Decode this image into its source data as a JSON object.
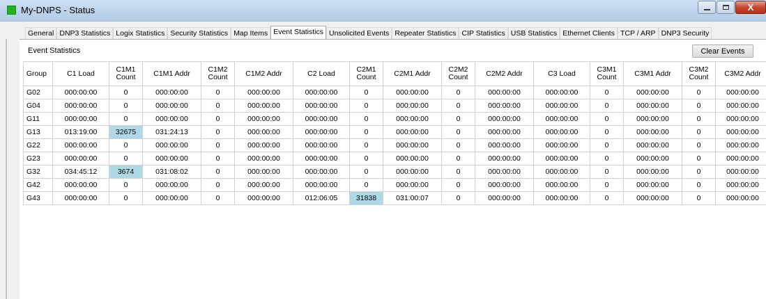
{
  "window": {
    "title": "My-DNPS - Status",
    "icon_color": "#1fb31f",
    "minimize_icon": "minimize-icon",
    "maximize_icon": "maximize-icon",
    "close_label": "X"
  },
  "tabs": [
    {
      "label": "General",
      "active": false
    },
    {
      "label": "DNP3 Statistics",
      "active": false
    },
    {
      "label": "Logix Statistics",
      "active": false
    },
    {
      "label": "Security Statistics",
      "active": false
    },
    {
      "label": "Map Items",
      "active": false
    },
    {
      "label": "Event Statistics",
      "active": true
    },
    {
      "label": "Unsolicited Events",
      "active": false
    },
    {
      "label": "Repeater Statistics",
      "active": false
    },
    {
      "label": "CIP Statistics",
      "active": false
    },
    {
      "label": "USB Statistics",
      "active": false
    },
    {
      "label": "Ethernet Clients",
      "active": false
    },
    {
      "label": "TCP / ARP",
      "active": false
    },
    {
      "label": "DNP3 Security",
      "active": false
    }
  ],
  "panel": {
    "title": "Event Statistics",
    "clear_button": "Clear Events"
  },
  "table": {
    "highlight_color": "#add8e6",
    "headers": [
      [
        "Group"
      ],
      [
        "C1 Load"
      ],
      [
        "C1M1",
        "Count"
      ],
      [
        "C1M1 Addr"
      ],
      [
        "C1M2",
        "Count"
      ],
      [
        "C1M2 Addr"
      ],
      [
        "C2 Load"
      ],
      [
        "C2M1",
        "Count"
      ],
      [
        "C2M1 Addr"
      ],
      [
        "C2M2",
        "Count"
      ],
      [
        "C2M2 Addr"
      ],
      [
        "C3 Load"
      ],
      [
        "C3M1",
        "Count"
      ],
      [
        "C3M1 Addr"
      ],
      [
        "C3M2",
        "Count"
      ],
      [
        "C3M2 Addr"
      ]
    ],
    "rows": [
      {
        "cells": [
          "G02",
          "000:00:00",
          "0",
          "000:00:00",
          "0",
          "000:00:00",
          "000:00:00",
          "0",
          "000:00:00",
          "0",
          "000:00:00",
          "000:00:00",
          "0",
          "000:00:00",
          "0",
          "000:00:00"
        ],
        "highlight": []
      },
      {
        "cells": [
          "G04",
          "000:00:00",
          "0",
          "000:00:00",
          "0",
          "000:00:00",
          "000:00:00",
          "0",
          "000:00:00",
          "0",
          "000:00:00",
          "000:00:00",
          "0",
          "000:00:00",
          "0",
          "000:00:00"
        ],
        "highlight": []
      },
      {
        "cells": [
          "G11",
          "000:00:00",
          "0",
          "000:00:00",
          "0",
          "000:00:00",
          "000:00:00",
          "0",
          "000:00:00",
          "0",
          "000:00:00",
          "000:00:00",
          "0",
          "000:00:00",
          "0",
          "000:00:00"
        ],
        "highlight": []
      },
      {
        "cells": [
          "G13",
          "013:19:00",
          "32675",
          "031:24:13",
          "0",
          "000:00:00",
          "000:00:00",
          "0",
          "000:00:00",
          "0",
          "000:00:00",
          "000:00:00",
          "0",
          "000:00:00",
          "0",
          "000:00:00"
        ],
        "highlight": [
          2
        ]
      },
      {
        "cells": [
          "G22",
          "000:00:00",
          "0",
          "000:00:00",
          "0",
          "000:00:00",
          "000:00:00",
          "0",
          "000:00:00",
          "0",
          "000:00:00",
          "000:00:00",
          "0",
          "000:00:00",
          "0",
          "000:00:00"
        ],
        "highlight": []
      },
      {
        "cells": [
          "G23",
          "000:00:00",
          "0",
          "000:00:00",
          "0",
          "000:00:00",
          "000:00:00",
          "0",
          "000:00:00",
          "0",
          "000:00:00",
          "000:00:00",
          "0",
          "000:00:00",
          "0",
          "000:00:00"
        ],
        "highlight": []
      },
      {
        "cells": [
          "G32",
          "034:45:12",
          "3674",
          "031:08:02",
          "0",
          "000:00:00",
          "000:00:00",
          "0",
          "000:00:00",
          "0",
          "000:00:00",
          "000:00:00",
          "0",
          "000:00:00",
          "0",
          "000:00:00"
        ],
        "highlight": [
          2
        ]
      },
      {
        "cells": [
          "G42",
          "000:00:00",
          "0",
          "000:00:00",
          "0",
          "000:00:00",
          "000:00:00",
          "0",
          "000:00:00",
          "0",
          "000:00:00",
          "000:00:00",
          "0",
          "000:00:00",
          "0",
          "000:00:00"
        ],
        "highlight": []
      },
      {
        "cells": [
          "G43",
          "000:00:00",
          "0",
          "000:00:00",
          "0",
          "000:00:00",
          "012:06:05",
          "31838",
          "031:00:07",
          "0",
          "000:00:00",
          "000:00:00",
          "0",
          "000:00:00",
          "0",
          "000:00:00"
        ],
        "highlight": [
          7
        ]
      }
    ]
  }
}
